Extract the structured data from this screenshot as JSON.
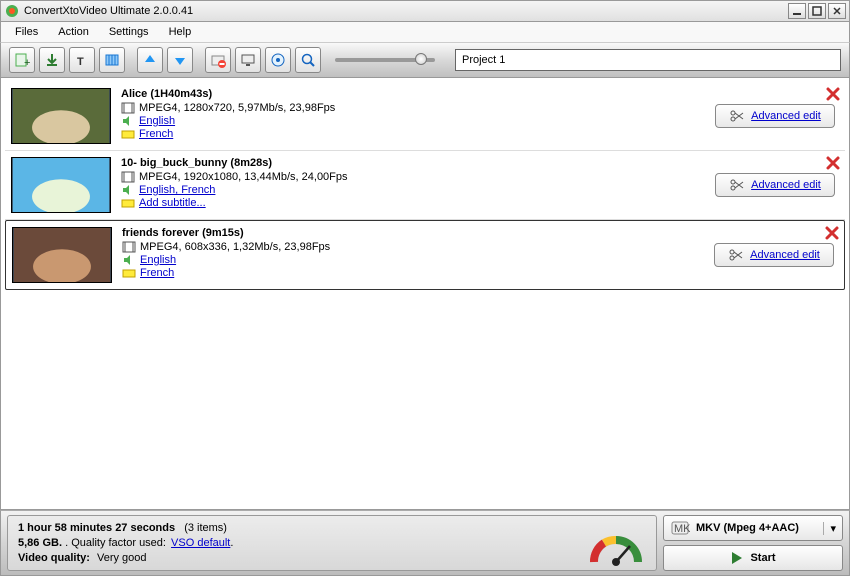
{
  "window": {
    "title": "ConvertXtoVideo Ultimate 2.0.0.41"
  },
  "menu": {
    "files": "Files",
    "action": "Action",
    "settings": "Settings",
    "help": "Help"
  },
  "toolbar": {
    "project_name": "Project 1"
  },
  "items": [
    {
      "title": "Alice (1H40m43s)",
      "spec": "MPEG4, 1280x720, 5,97Mb/s, 23,98Fps",
      "audio": "English",
      "subtitle": "French",
      "advanced": "Advanced edit",
      "thumb_fill1": "#5a6b3a",
      "thumb_fill2": "#d9c7a0"
    },
    {
      "title": "10- big_buck_bunny (8m28s)",
      "spec": "MPEG4, 1920x1080, 13,44Mb/s, 24,00Fps",
      "audio": "English, French",
      "subtitle": "Add subtitle...",
      "advanced": "Advanced edit",
      "thumb_fill1": "#5bb6e6",
      "thumb_fill2": "#e8f4d8"
    },
    {
      "title": "friends forever (9m15s)",
      "spec": "MPEG4, 608x336, 1,32Mb/s, 23,98Fps",
      "audio": "English",
      "subtitle": "French",
      "advanced": "Advanced edit",
      "thumb_fill1": "#6b4a3a",
      "thumb_fill2": "#c99870"
    }
  ],
  "footer": {
    "duration": "1 hour 58 minutes 27 seconds",
    "items_count": "(3 items)",
    "size": "5,86 GB.",
    "quality_factor_label": ". Quality factor used:",
    "quality_factor": "VSO default",
    "dot": ".",
    "video_quality_label": "Video quality:",
    "video_quality": "Very good",
    "format": "MKV (Mpeg 4+AAC)",
    "start": "Start"
  }
}
